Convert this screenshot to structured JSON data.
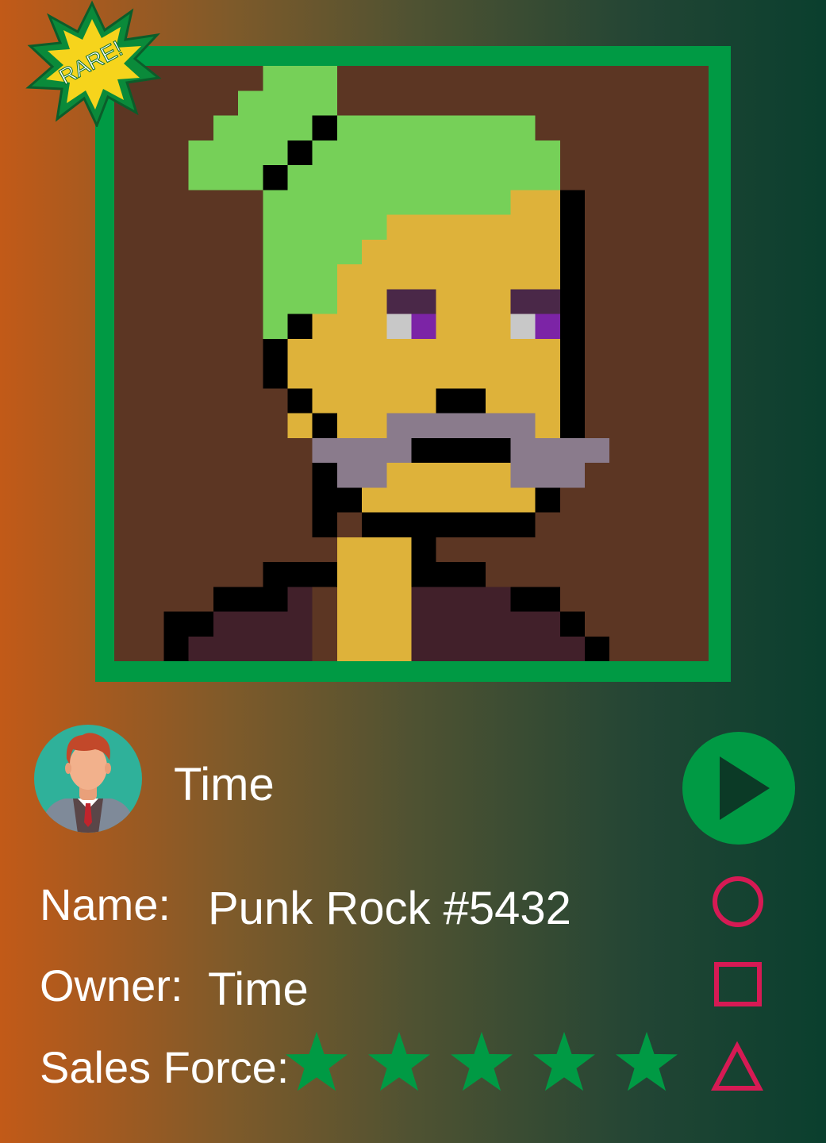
{
  "badge": {
    "text": "RARE!"
  },
  "user": {
    "name": "Time"
  },
  "fields": {
    "name_label": "Name:",
    "name_value": "Punk Rock #5432",
    "owner_label": "Owner:",
    "owner_value": "Time",
    "sales_label": "Sales Force:",
    "sales_rating": 5,
    "sales_max": 5
  },
  "icons": {
    "play": "play-icon",
    "circle": "circle-icon",
    "square": "square-icon",
    "triangle": "triangle-icon",
    "star": "star-icon"
  },
  "colors": {
    "frame_green": "#009a44",
    "art_background": "#5c3623",
    "hair_green": "#76d058",
    "skin_yellow": "#deb23a",
    "beard_grey": "#8a7b8c",
    "eye_purple": "#7c24a6",
    "jacket": "#41202a",
    "accent_pink": "#d61a54",
    "star_green": "#009a44"
  }
}
